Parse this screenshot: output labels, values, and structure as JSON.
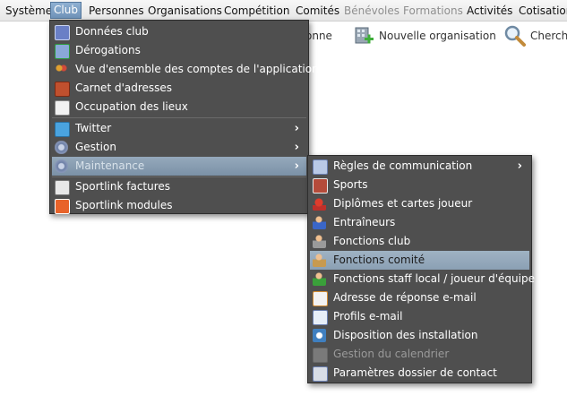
{
  "menubar": {
    "items": [
      {
        "label": "Système",
        "state": "normal"
      },
      {
        "label": "Club",
        "state": "active"
      },
      {
        "label": "Personnes",
        "state": "normal"
      },
      {
        "label": "Organisations",
        "state": "normal"
      },
      {
        "label": "Compétition",
        "state": "normal"
      },
      {
        "label": "Comités",
        "state": "normal"
      },
      {
        "label": "Bénévoles",
        "state": "disabled"
      },
      {
        "label": "Formations",
        "state": "disabled"
      },
      {
        "label": "Activités",
        "state": "normal"
      },
      {
        "label": "Cotisation",
        "state": "normal"
      }
    ]
  },
  "toolbar": {
    "partial_label": "onne",
    "new_org_label": "Nouvelle organisation",
    "search_label": "Cherch"
  },
  "club_menu": {
    "items": [
      {
        "label": "Données club",
        "icon": "club-data-icon"
      },
      {
        "label": "Dérogations",
        "icon": "derogations-icon"
      },
      {
        "label": "Vue d'ensemble des comptes de l'application",
        "icon": "accounts-overview-icon"
      },
      {
        "label": "Carnet d'adresses",
        "icon": "address-book-icon"
      },
      {
        "label": "Occupation des lieux",
        "icon": "venue-occupation-icon"
      },
      {
        "label": "Twitter",
        "icon": "twitter-icon"
      },
      {
        "label": "Gestion",
        "icon": "gear-icon"
      },
      {
        "label": "Maintenance",
        "icon": "gear-icon"
      },
      {
        "label": "Sportlink factures",
        "icon": "invoice-icon"
      },
      {
        "label": "Sportlink modules",
        "icon": "modules-icon"
      }
    ]
  },
  "maintenance_menu": {
    "items": [
      {
        "label": "Règles de communication",
        "icon": "communication-rules-icon"
      },
      {
        "label": "Sports",
        "icon": "sports-icon"
      },
      {
        "label": "Diplômes et cartes joueur",
        "icon": "diploma-icon"
      },
      {
        "label": "Entraîneurs",
        "icon": "coach-icon"
      },
      {
        "label": "Fonctions club",
        "icon": "club-function-icon"
      },
      {
        "label": "Fonctions comité",
        "icon": "committee-function-icon"
      },
      {
        "label": "Fonctions staff local / joueur d'équipe",
        "icon": "staff-function-icon"
      },
      {
        "label": "Adresse de réponse e-mail",
        "icon": "reply-email-icon"
      },
      {
        "label": "Profils e-mail",
        "icon": "email-profile-icon"
      },
      {
        "label": "Disposition des installation",
        "icon": "installation-layout-icon"
      },
      {
        "label": "Gestion du calendrier",
        "icon": "calendar-icon"
      },
      {
        "label": "Paramètres dossier de contact",
        "icon": "contact-settings-icon"
      }
    ]
  }
}
